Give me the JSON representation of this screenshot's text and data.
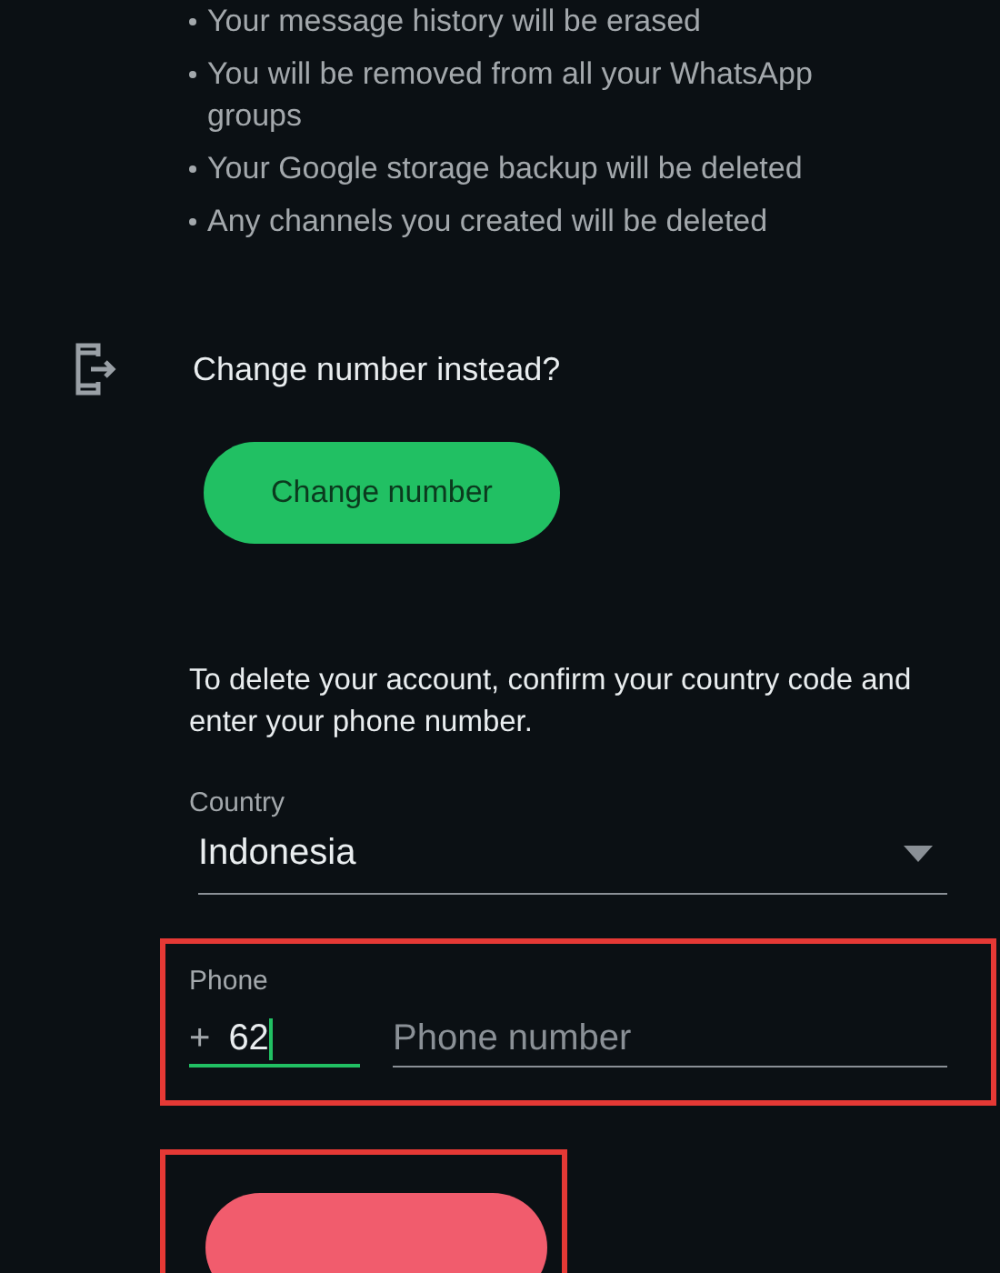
{
  "consequences": [
    "Your message history will be erased",
    "You will be removed from all your WhatsApp groups",
    "Your Google storage backup will be deleted",
    "Any channels you created will be deleted"
  ],
  "change_number": {
    "heading": "Change number instead?",
    "button": "Change number"
  },
  "instructions": "To delete your account, confirm your country code and enter your phone number.",
  "country": {
    "label": "Country",
    "value": "Indonesia"
  },
  "phone": {
    "label": "Phone",
    "prefix": "+",
    "code": "62",
    "code_focused": true,
    "placeholder": "Phone number",
    "highlighted": true
  },
  "delete_button": {
    "highlighted": true
  }
}
